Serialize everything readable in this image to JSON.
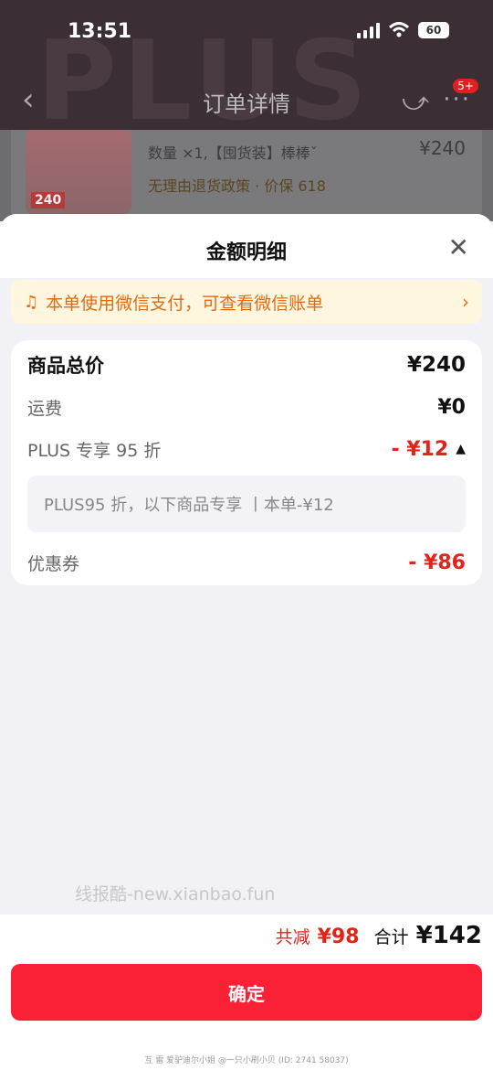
{
  "status_bar": {
    "time": "13:51",
    "battery": "60"
  },
  "nav": {
    "title": "订单详情",
    "badge": "5+"
  },
  "product": {
    "quantity_text": "数量 ×1,【囤货装】棒棒ˇ",
    "policy_text": "无理由退货政策 · 价保 618",
    "price": "¥240",
    "thumb_price": "240"
  },
  "sheet": {
    "title": "金额明细",
    "notice": "本单使用微信支付，可查看微信账单"
  },
  "details": {
    "total_label": "商品总价",
    "total_value": "¥240",
    "shipping_label": "运费",
    "shipping_value": "¥0",
    "plus_label": "PLUS 专享 95 折",
    "plus_value": "- ¥12",
    "plus_note": "PLUS95 折，以下商品专享 丨本单-¥12",
    "coupon_label": "优惠券",
    "coupon_value": "- ¥86"
  },
  "watermark": "线报酷-new.xianbao.fun",
  "bottom": {
    "discount_label": "共减",
    "discount_value": "¥98",
    "total_label": "合计",
    "total_value": "¥142",
    "confirm_label": "确定"
  },
  "footer_note": "互 雷 爱驴迪尔小姐 @一只小刷小贝 (ID: 2741 58037)",
  "colors": {
    "accent_red": "#fa2137",
    "notice_orange": "#e36b12"
  }
}
